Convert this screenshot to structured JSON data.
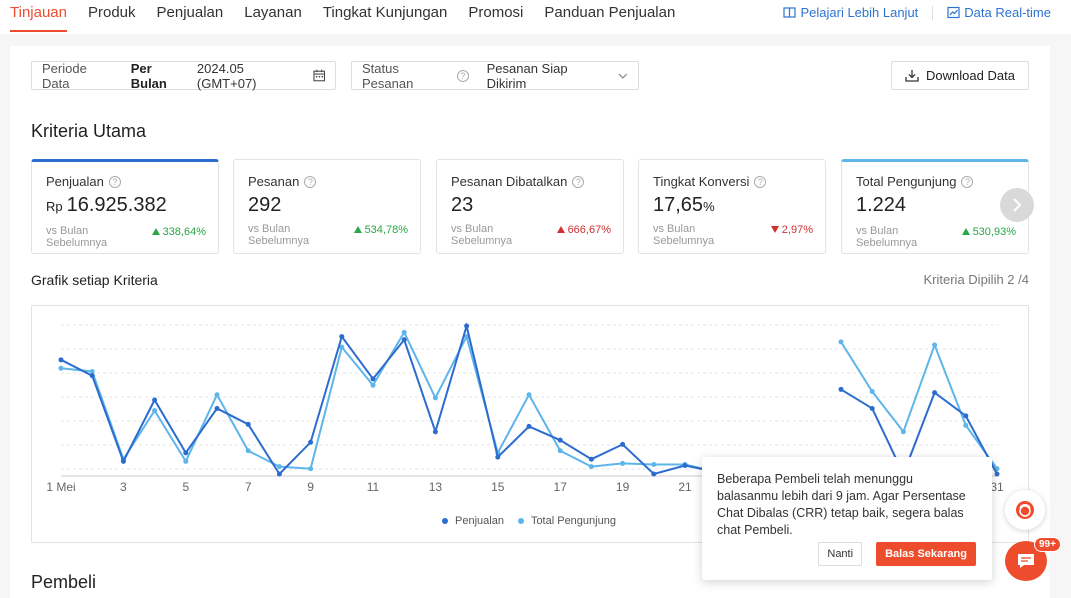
{
  "nav": {
    "tabs": [
      "Tinjauan",
      "Produk",
      "Penjualan",
      "Layanan",
      "Tingkat Kunjungan",
      "Promosi",
      "Panduan Penjualan"
    ],
    "active_tab": 0,
    "learn_more": "Pelajari Lebih Lanjut",
    "realtime": "Data Real-time"
  },
  "filters": {
    "period_label": "Periode Data",
    "period_type": "Per Bulan",
    "period_value": "2024.05 (GMT+07)",
    "status_label": "Status Pesanan",
    "status_value": "Pesanan Siap Dikirim",
    "download": "Download Data"
  },
  "key_criteria": {
    "title": "Kriteria Utama",
    "cards": [
      {
        "title": "Penjualan",
        "prefix": "Rp",
        "value": "16.925.382",
        "suffix": "",
        "compare": "vs Bulan Sebelumnya",
        "change": "338,64%",
        "direction": "up"
      },
      {
        "title": "Pesanan",
        "prefix": "",
        "value": "292",
        "suffix": "",
        "compare": "vs Bulan Sebelumnya",
        "change": "534,78%",
        "direction": "up"
      },
      {
        "title": "Pesanan Dibatalkan",
        "prefix": "",
        "value": "23",
        "suffix": "",
        "compare": "vs Bulan Sebelumnya",
        "change": "666,67%",
        "direction": "up-red"
      },
      {
        "title": "Tingkat Konversi",
        "prefix": "",
        "value": "17,65",
        "suffix": "%",
        "compare": "vs Bulan Sebelumnya",
        "change": "2,97%",
        "direction": "down"
      },
      {
        "title": "Total Pengunjung",
        "prefix": "",
        "value": "1.224",
        "suffix": "",
        "compare": "vs Bulan Sebelumnya",
        "change": "530,93%",
        "direction": "up"
      }
    ]
  },
  "chart_section": {
    "title": "Grafik setiap Kriteria",
    "selected": "Kriteria Dipilih 2 /4"
  },
  "buyers_title": "Pembeli",
  "chart_data": {
    "type": "line",
    "x": [
      1,
      2,
      3,
      4,
      5,
      6,
      7,
      8,
      9,
      10,
      11,
      12,
      13,
      14,
      15,
      16,
      17,
      18,
      19,
      20,
      21,
      22,
      23,
      24,
      25,
      26,
      27,
      28,
      29,
      30,
      31
    ],
    "x_tick_labels": [
      "1 Mei",
      "3",
      "5",
      "7",
      "9",
      "11",
      "13",
      "15",
      "17",
      "19",
      "21",
      "31"
    ],
    "series": [
      {
        "name": "Penjualan",
        "color": "#2d6ccf",
        "values": [
          108,
          93,
          12,
          70,
          20,
          62,
          47,
          0,
          30,
          130,
          90,
          127,
          40,
          140,
          16,
          45,
          32,
          14,
          28,
          0,
          8,
          2,
          null,
          null,
          null,
          80,
          62,
          0,
          77,
          55,
          0
        ]
      },
      {
        "name": "Total Pengunjung",
        "color": "#5db5ea",
        "values": [
          100,
          97,
          14,
          60,
          12,
          75,
          22,
          7,
          5,
          120,
          84,
          134,
          72,
          130,
          20,
          75,
          22,
          7,
          10,
          9,
          9,
          2,
          null,
          null,
          null,
          125,
          78,
          40,
          122,
          46,
          5
        ]
      }
    ],
    "legend_position": "bottom",
    "grid": true
  },
  "popup": {
    "message": "Beberapa Pembeli telah menunggu balasanmu lebih dari 9 jam. Agar Persentase Chat Dibalas (CRR) tetap baik, segera balas chat Pembeli.",
    "later": "Nanti",
    "reply": "Balas Sekarang"
  },
  "chat_badge": "99+"
}
